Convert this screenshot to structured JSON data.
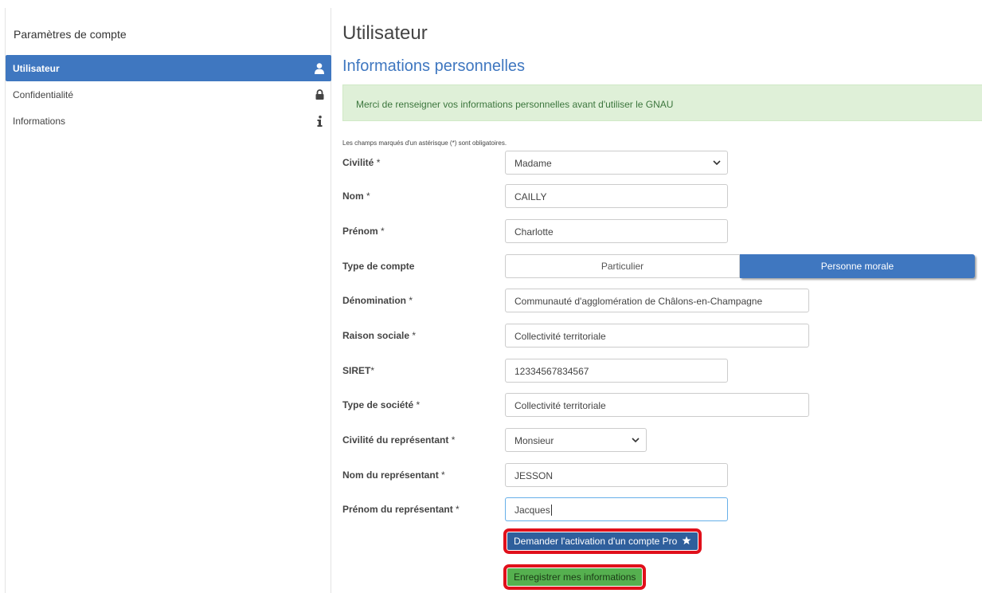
{
  "sidebar": {
    "title": "Paramètres de compte",
    "items": [
      {
        "label": "Utilisateur",
        "icon": "user-icon",
        "active": true
      },
      {
        "label": "Confidentialité",
        "icon": "lock-icon",
        "active": false
      },
      {
        "label": "Informations",
        "icon": "info-icon",
        "active": false
      }
    ]
  },
  "main": {
    "title": "Utilisateur",
    "section_title": "Informations personnelles",
    "alert": "Merci de renseigner vos informations personnelles avant d'utiliser le GNAU",
    "required_note": "Les champs marqués d'un astérisque (*) sont obligatoires."
  },
  "form": {
    "civilite": {
      "label": "Civilité",
      "required": "*",
      "value": "Madame"
    },
    "nom": {
      "label": "Nom",
      "required": "*",
      "value": "CAILLY"
    },
    "prenom": {
      "label": "Prénom",
      "required": "*",
      "value": "Charlotte"
    },
    "type_compte": {
      "label": "Type de compte",
      "options": [
        "Particulier",
        "Personne morale"
      ],
      "selected": "Personne morale"
    },
    "denomination": {
      "label": "Dénomination",
      "required": "*",
      "value": "Communauté d'agglomération de Châlons-en-Champagne"
    },
    "raison_sociale": {
      "label": "Raison sociale",
      "required": "*",
      "value": "Collectivité territoriale"
    },
    "siret": {
      "label": "SIRET",
      "required": "*",
      "value": "12334567834567"
    },
    "type_societe": {
      "label": "Type de société",
      "required": "*",
      "value": "Collectivité territoriale"
    },
    "civilite_rep": {
      "label": "Civilité du représentant",
      "required": "*",
      "value": "Monsieur"
    },
    "nom_rep": {
      "label": "Nom du représentant",
      "required": "*",
      "value": "JESSON"
    },
    "prenom_rep": {
      "label": "Prénom du représentant",
      "required": "*",
      "value": "Jacques"
    }
  },
  "buttons": {
    "pro": "Demander l'activation d'un compte Pro",
    "save": "Enregistrer mes informations"
  },
  "colors": {
    "accent": "#3f77c0",
    "alert_bg": "#dff0d8",
    "alert_text": "#3c763d",
    "save_button": "#55b04f",
    "highlight_border": "#e0101b"
  }
}
